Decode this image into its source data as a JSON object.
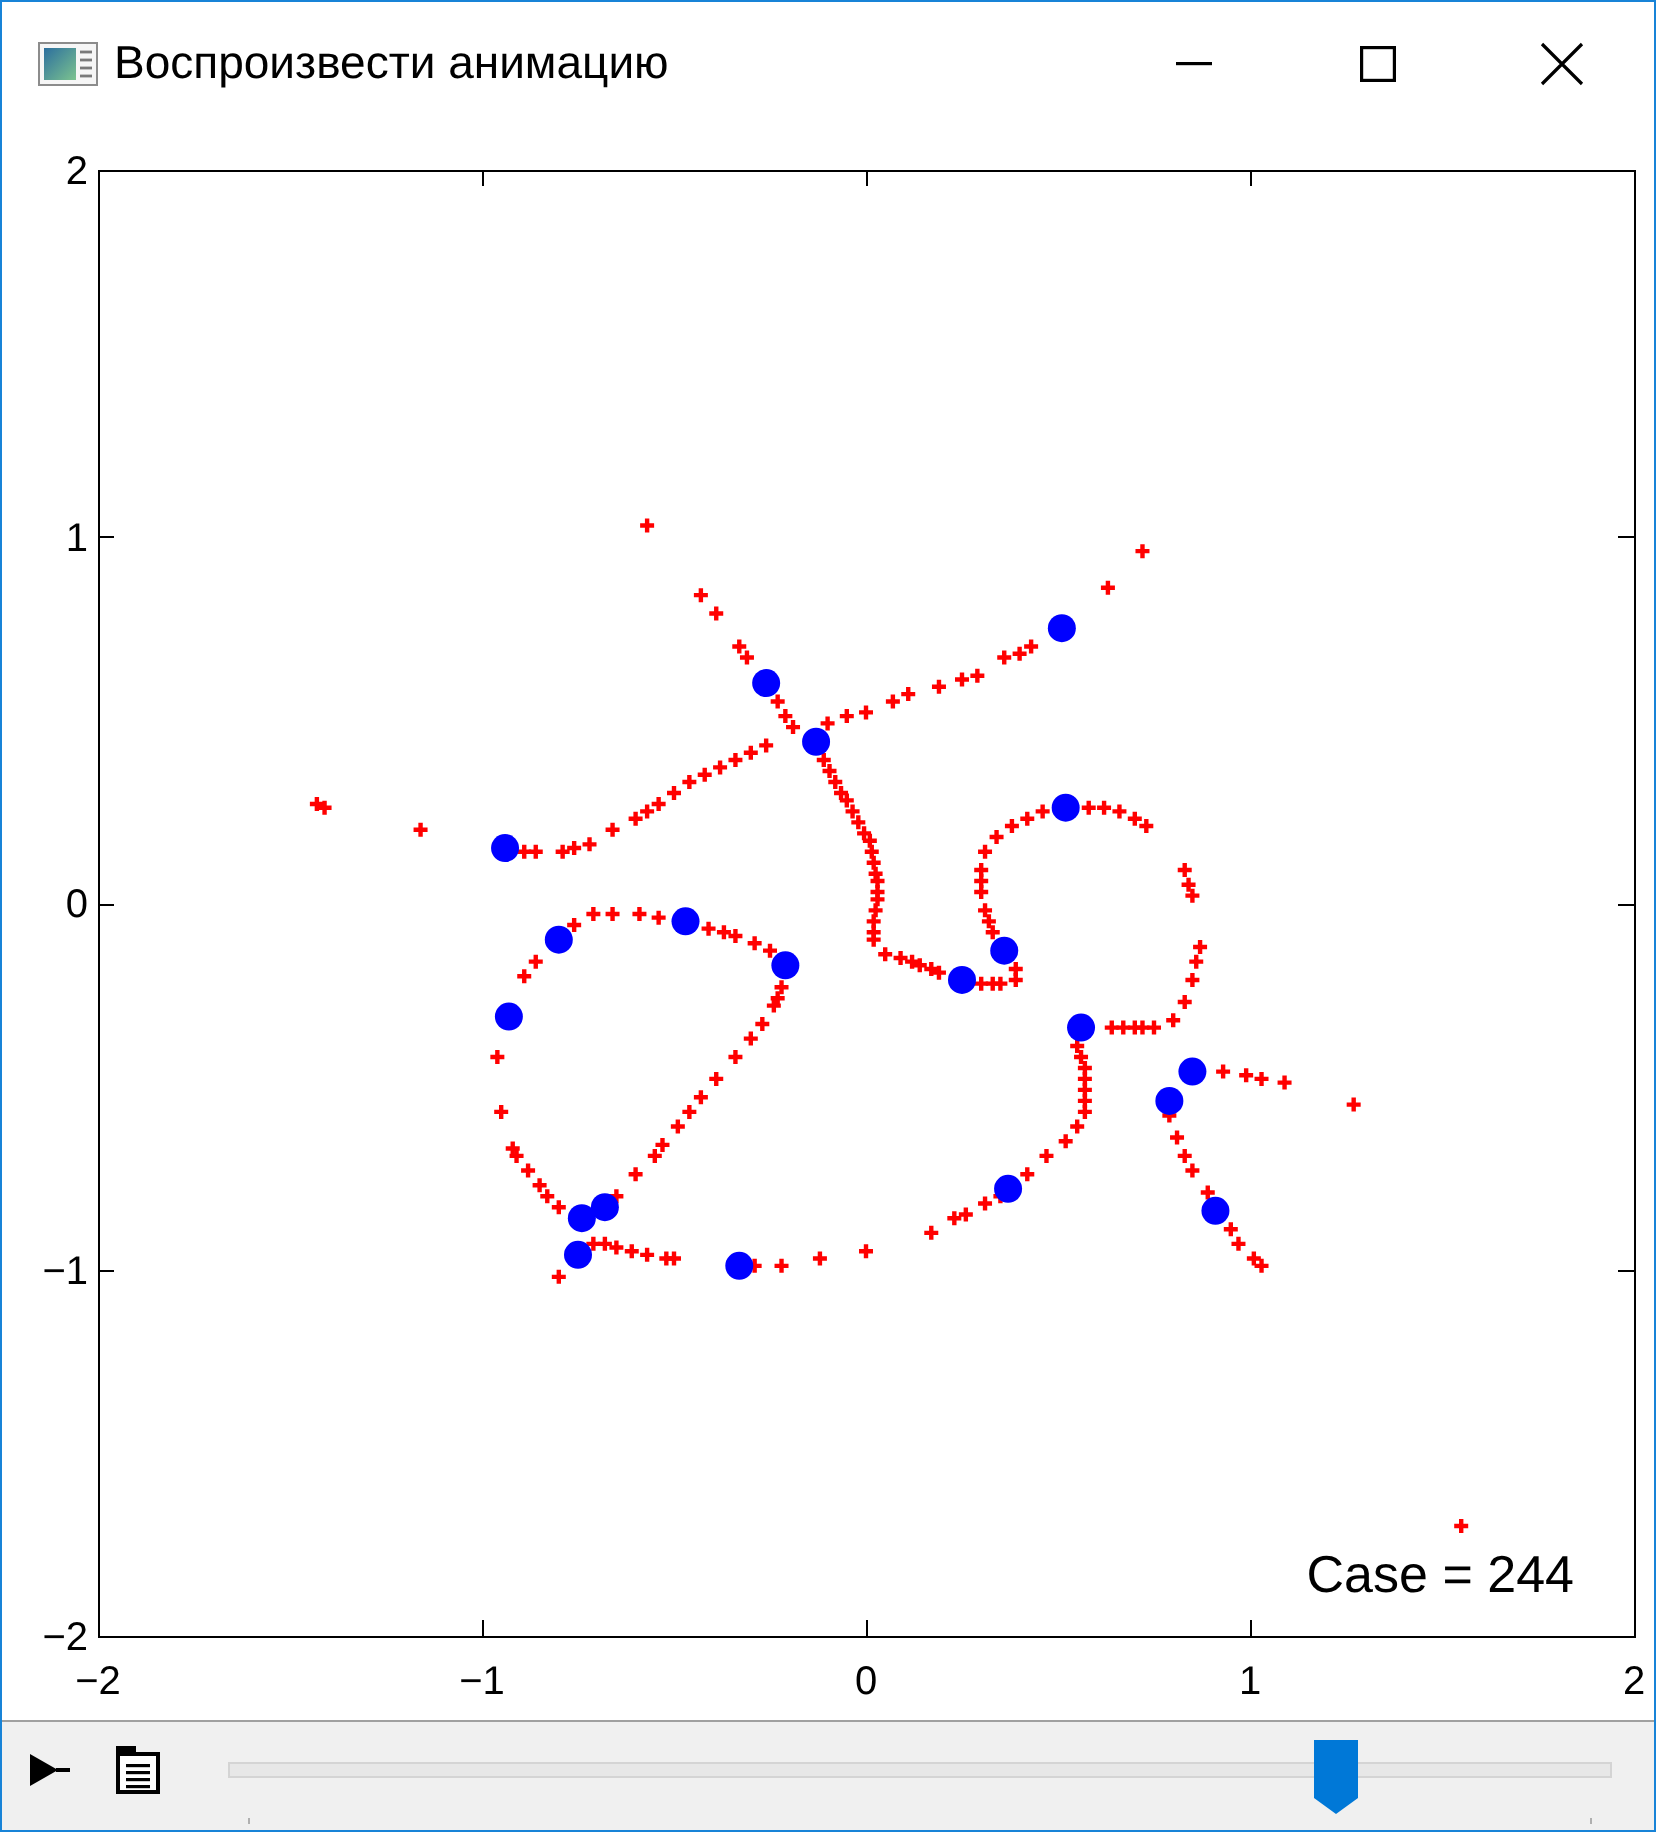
{
  "window": {
    "title": "Воспроизвести анимацию"
  },
  "figure": {
    "chart_data": {
      "type": "scatter",
      "xlim": [
        -2,
        2
      ],
      "ylim": [
        -2,
        2
      ],
      "xticks": [
        {
          "value": -2,
          "label": "−2"
        },
        {
          "value": -1,
          "label": "−1"
        },
        {
          "value": 0,
          "label": "0"
        },
        {
          "value": 1,
          "label": "1"
        },
        {
          "value": 2,
          "label": "2"
        }
      ],
      "yticks": [
        {
          "value": -2,
          "label": "−2"
        },
        {
          "value": -1,
          "label": "−1"
        },
        {
          "value": 0,
          "label": "0"
        },
        {
          "value": 1,
          "label": "1"
        },
        {
          "value": 2,
          "label": "2"
        }
      ],
      "series": [
        {
          "color": "#ff0000",
          "x": [
            -0.57,
            -0.43,
            -0.39,
            -0.33,
            -0.31,
            -0.23,
            -0.21,
            -0.19,
            -0.26,
            -0.3,
            -0.34,
            -0.38,
            -0.42,
            -0.46,
            -0.5,
            -0.54,
            -0.57,
            -0.6,
            -0.66,
            -0.72,
            -0.76,
            -0.79,
            -0.86,
            -0.89,
            -1.43,
            -1.41,
            -1.16,
            -0.1,
            -0.05,
            0,
            0.07,
            0.11,
            0.19,
            0.25,
            0.29,
            0.36,
            0.4,
            0.43,
            0.63,
            0.72,
            -0.11,
            -0.095,
            -0.08,
            -0.065,
            -0.05,
            -0.035,
            -0.02,
            -0.005,
            0.01,
            0.015,
            0.02,
            0.025,
            0.03,
            0.03,
            0.03,
            0.025,
            0.02,
            0.02,
            0.02,
            0.05,
            0.09,
            0.12,
            0.14,
            0.17,
            0.19,
            0.3,
            0.33,
            0.35,
            0.39,
            0.39,
            0.33,
            0.32,
            0.31,
            0.3,
            0.3,
            0.3,
            0.31,
            0.34,
            0.38,
            0.42,
            0.46,
            0.58,
            0.62,
            0.66,
            0.7,
            0.73,
            0.83,
            0.84,
            0.85,
            0.87,
            0.86,
            0.85,
            0.83,
            0.8,
            0.75,
            0.72,
            0.7,
            0.67,
            0.64,
            0.55,
            0.56,
            0.57,
            0.57,
            0.57,
            0.57,
            0.57,
            0.55,
            0.52,
            0.47,
            0.42,
            0.35,
            0.31,
            0.26,
            0.23,
            0.17,
            0,
            0.93,
            0.99,
            1.03,
            1.09,
            1.27,
            0.79,
            0.81,
            0.83,
            0.85,
            0.89,
            0.95,
            0.97,
            1.01,
            1.03,
            1.55,
            -0.76,
            -0.71,
            -0.66,
            -0.59,
            -0.54,
            -0.41,
            -0.37,
            -0.34,
            -0.29,
            -0.25,
            -0.22,
            -0.23,
            -0.24,
            -0.27,
            -0.3,
            -0.34,
            -0.39,
            -0.43,
            -0.46,
            -0.49,
            -0.53,
            -0.55,
            -0.6,
            -0.65,
            -0.86,
            -0.89,
            -0.96,
            -0.95,
            -0.92,
            -0.91,
            -0.88,
            -0.85,
            -0.83,
            -0.8,
            -0.71,
            -0.68,
            -0.65,
            -0.61,
            -0.57,
            -0.52,
            -0.5,
            -0.29,
            -0.22,
            -0.12,
            -0.8
          ],
          "values": [
            1.03,
            0.84,
            0.79,
            0.7,
            0.67,
            0.55,
            0.51,
            0.48,
            0.43,
            0.41,
            0.39,
            0.37,
            0.35,
            0.33,
            0.3,
            0.27,
            0.25,
            0.23,
            0.2,
            0.16,
            0.15,
            0.14,
            0.14,
            0.14,
            0.27,
            0.26,
            0.2,
            0.49,
            0.51,
            0.52,
            0.55,
            0.57,
            0.59,
            0.61,
            0.62,
            0.67,
            0.68,
            0.7,
            0.86,
            0.96,
            0.39,
            0.36,
            0.33,
            0.3,
            0.28,
            0.25,
            0.22,
            0.19,
            0.17,
            0.14,
            0.11,
            0.08,
            0.06,
            0.03,
            0.01,
            -0.02,
            -0.05,
            -0.08,
            -0.1,
            -0.14,
            -0.15,
            -0.16,
            -0.17,
            -0.18,
            -0.19,
            -0.22,
            -0.22,
            -0.22,
            -0.21,
            -0.18,
            -0.08,
            -0.05,
            -0.02,
            0.03,
            0.06,
            0.09,
            0.14,
            0.18,
            0.21,
            0.23,
            0.25,
            0.26,
            0.26,
            0.25,
            0.23,
            0.21,
            0.09,
            0.05,
            0.02,
            -0.12,
            -0.16,
            -0.21,
            -0.27,
            -0.32,
            -0.34,
            -0.34,
            -0.34,
            -0.34,
            -0.34,
            -0.39,
            -0.42,
            -0.45,
            -0.48,
            -0.51,
            -0.54,
            -0.57,
            -0.61,
            -0.65,
            -0.69,
            -0.74,
            -0.8,
            -0.82,
            -0.85,
            -0.86,
            -0.9,
            -0.95,
            -0.46,
            -0.47,
            -0.48,
            -0.49,
            -0.55,
            -0.58,
            -0.64,
            -0.69,
            -0.73,
            -0.79,
            -0.89,
            -0.93,
            -0.97,
            -0.99,
            -1.7,
            -0.06,
            -0.03,
            -0.03,
            -0.03,
            -0.04,
            -0.07,
            -0.08,
            -0.09,
            -0.11,
            -0.13,
            -0.23,
            -0.26,
            -0.28,
            -0.33,
            -0.37,
            -0.42,
            -0.48,
            -0.53,
            -0.57,
            -0.61,
            -0.66,
            -0.69,
            -0.74,
            -0.8,
            -0.16,
            -0.2,
            -0.42,
            -0.57,
            -0.67,
            -0.69,
            -0.73,
            -0.77,
            -0.8,
            -0.83,
            -0.93,
            -0.93,
            -0.94,
            -0.95,
            -0.96,
            -0.97,
            -0.97,
            -0.99,
            -0.99,
            -0.97,
            -1.02
          ]
        },
        {
          "color": "#0000ff",
          "x": [
            0.51,
            -0.26,
            -0.13,
            -0.94,
            0.52,
            -0.8,
            -0.47,
            -0.21,
            0.36,
            0.25,
            -0.93,
            0.56,
            0.85,
            0.79,
            0.91,
            0.37,
            -0.68,
            -0.74,
            -0.75,
            -0.33
          ],
          "values": [
            0.75,
            0.6,
            0.44,
            0.15,
            0.26,
            -0.1,
            -0.05,
            -0.17,
            -0.13,
            -0.21,
            -0.31,
            -0.34,
            -0.46,
            -0.54,
            -0.84,
            -0.78,
            -0.83,
            -0.86,
            -0.96,
            -0.99
          ]
        }
      ],
      "annotations": [
        {
          "text": "Case = 244"
        }
      ]
    }
  },
  "toolbar": {
    "slider": {
      "level": 0.81
    }
  }
}
